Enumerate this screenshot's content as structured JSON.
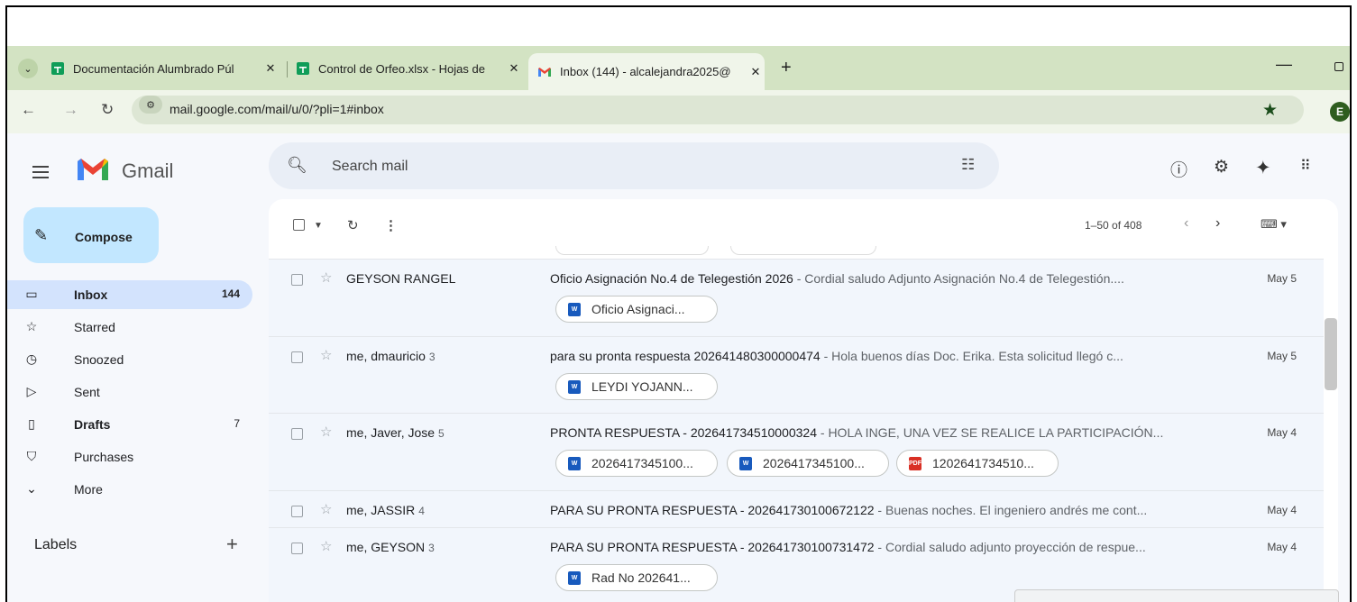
{
  "browser": {
    "tabs": [
      {
        "title": "Documentación Alumbrado Púl",
        "active": false,
        "favicon": "sheets-icon"
      },
      {
        "title": "Control de Orfeo.xlsx - Hojas de",
        "active": false,
        "favicon": "sheets-icon"
      },
      {
        "title": "Inbox (144) - alcalejandra2025@",
        "active": true,
        "favicon": "gmail-icon"
      }
    ],
    "tab_close": "✕",
    "new_tab": "+",
    "url": "mail.google.com/mail/u/0/?pli=1#inbox",
    "profile_initial": "E"
  },
  "gmail": {
    "logo_text": "Gmail",
    "search_placeholder": "Search mail",
    "compose_label": "Compose",
    "nav": [
      {
        "label": "Inbox",
        "count": "144",
        "bold": true,
        "active": true,
        "icon": "inbox-icon"
      },
      {
        "label": "Starred",
        "count": "",
        "bold": false,
        "active": false,
        "icon": "star-icon"
      },
      {
        "label": "Snoozed",
        "count": "",
        "bold": false,
        "active": false,
        "icon": "clock-icon"
      },
      {
        "label": "Sent",
        "count": "",
        "bold": false,
        "active": false,
        "icon": "send-icon"
      },
      {
        "label": "Drafts",
        "count": "7",
        "bold": true,
        "active": false,
        "icon": "draft-icon"
      },
      {
        "label": "Purchases",
        "count": "",
        "bold": false,
        "active": false,
        "icon": "bag-icon"
      },
      {
        "label": "More",
        "count": "",
        "bold": false,
        "active": false,
        "icon": "chevron-down-icon"
      }
    ],
    "labels_title": "Labels",
    "labels_add": "+",
    "pager": "1–50 of 408",
    "emails": [
      {
        "sender": "GEYSON RANGEL",
        "count": "",
        "subject": "Oficio Asignación No.4 de Telegestión 2026",
        "snippet": " - Cordial saludo Adjunto Asignación No.4 de Telegestión....",
        "date": "May 5",
        "attachments": [
          {
            "name": "Oficio Asignaci...",
            "type": "word"
          }
        ]
      },
      {
        "sender": "me, dmauricio",
        "count": "3",
        "subject": "para su pronta respuesta 202641480300000474",
        "snippet": " - Hola buenos días Doc. Erika. Esta solicitud llegó c...",
        "date": "May 5",
        "attachments": [
          {
            "name": "LEYDI YOJANN...",
            "type": "word"
          }
        ]
      },
      {
        "sender": "me, Javer, Jose",
        "count": "5",
        "subject": "PRONTA RESPUESTA - 202641734510000324",
        "snippet": " - HOLA INGE, UNA VEZ SE REALICE LA PARTICIPACIÓN...",
        "date": "May 4",
        "attachments": [
          {
            "name": "2026417345100...",
            "type": "word"
          },
          {
            "name": "2026417345100...",
            "type": "word"
          },
          {
            "name": "1202641734510...",
            "type": "pdf"
          }
        ]
      },
      {
        "sender": "me, JASSIR",
        "count": "4",
        "subject": "PARA SU PRONTA RESPUESTA - 202641730100672122",
        "snippet": " - Buenas noches. El ingeniero andrés me cont...",
        "date": "May 4",
        "attachments": []
      },
      {
        "sender": "me, GEYSON",
        "count": "3",
        "subject": "PARA SU PRONTA RESPUESTA - 202641730100731472",
        "snippet": " - Cordial saludo adjunto proyección de respue...",
        "date": "May 4",
        "attachments": [
          {
            "name": "Rad No 202641...",
            "type": "word"
          }
        ]
      }
    ]
  },
  "colors": {
    "tabstrip": "#d3e3c3",
    "compose": "#c2e7ff",
    "inbox_active": "#d3e3fd",
    "row_bg": "#f2f6fc"
  }
}
